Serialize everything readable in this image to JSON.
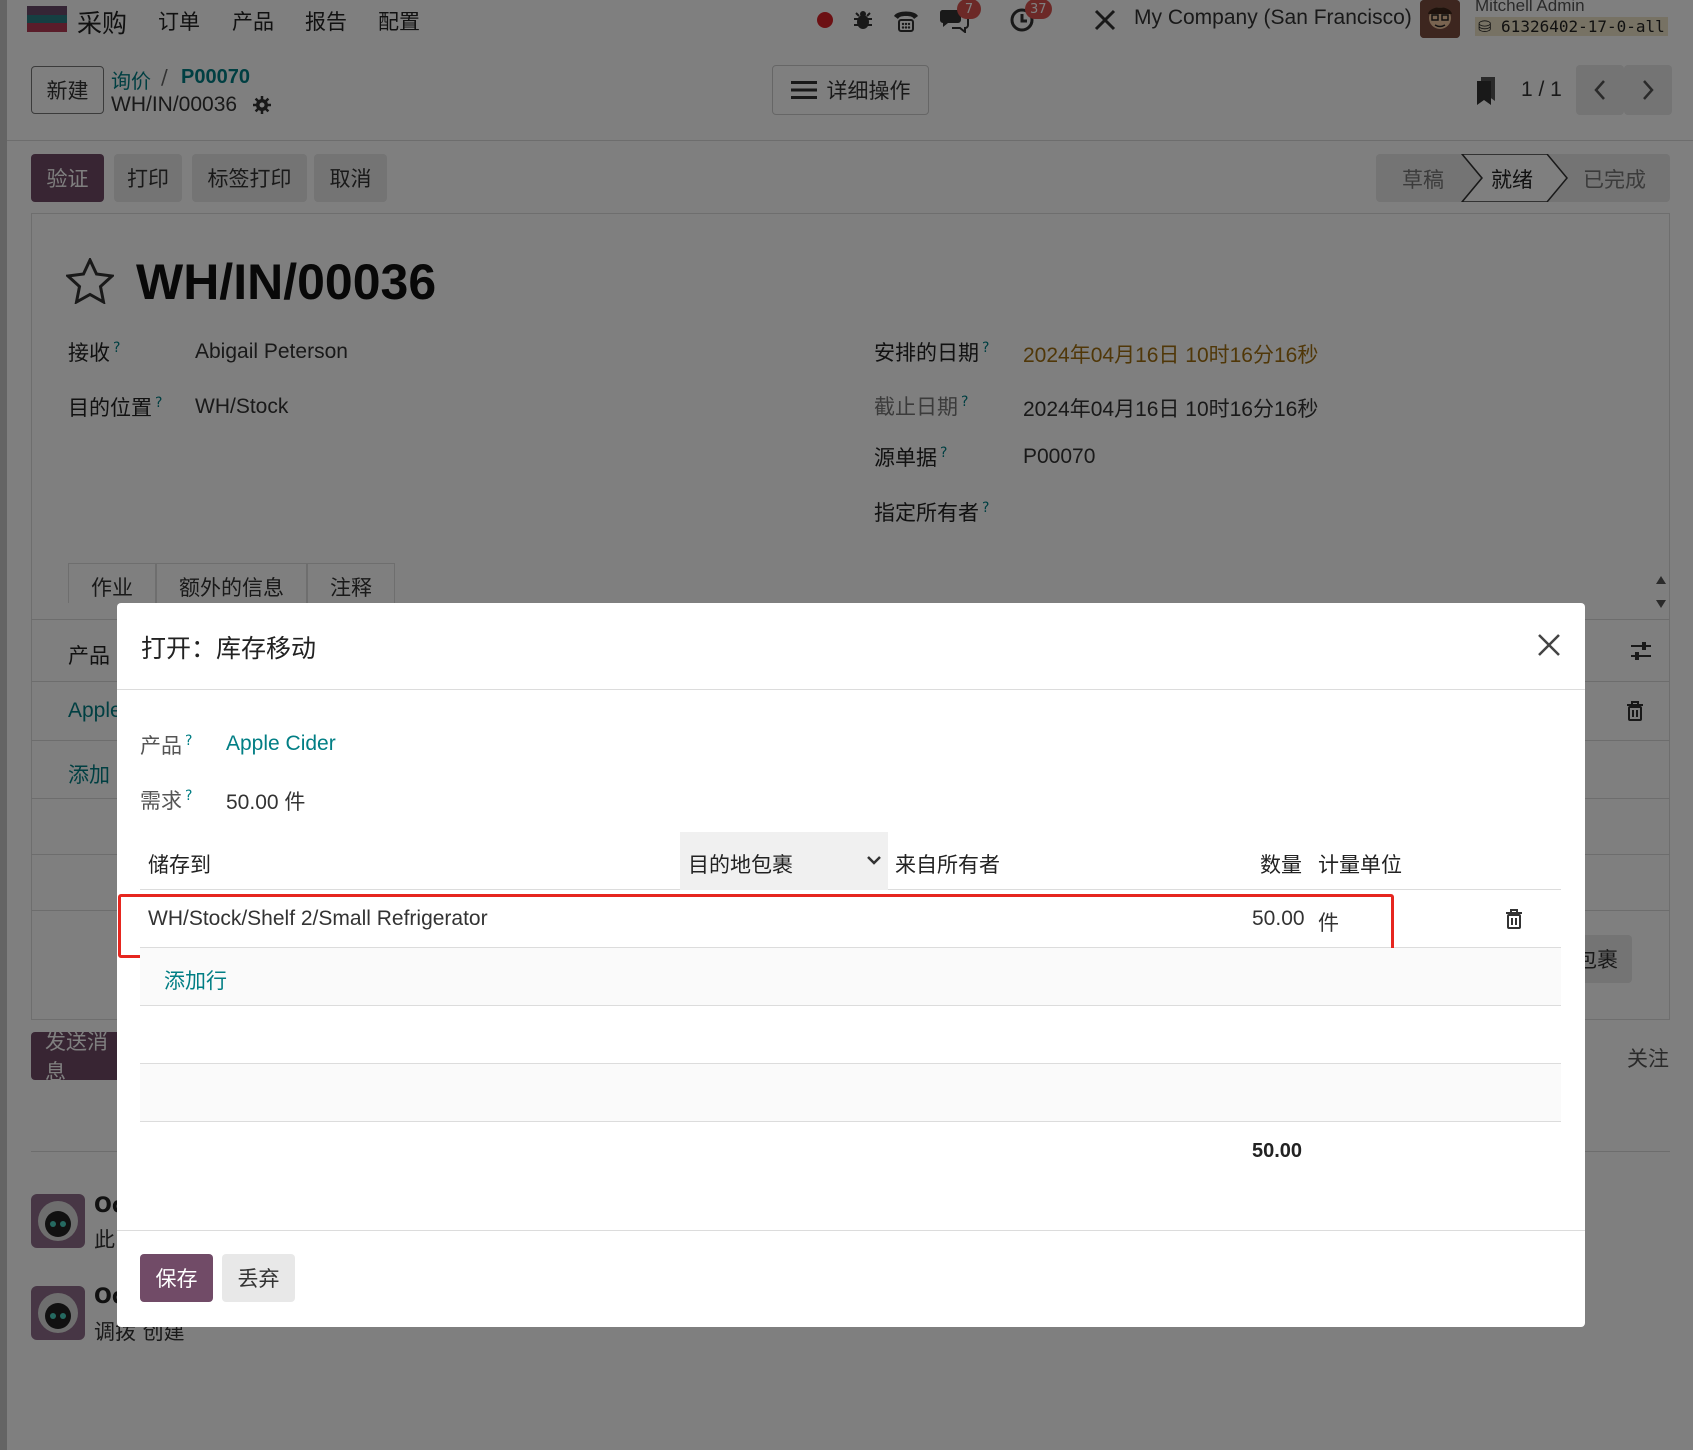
{
  "topnav": {
    "app_name": "采购",
    "menus": [
      "订单",
      "产品",
      "报告",
      "配置"
    ],
    "messages_badge": "7",
    "activities_badge": "37",
    "company": "My Company (San Francisco)",
    "user_name": "Mitchell Admin",
    "db_name": "61326402-17-0-all"
  },
  "control": {
    "new_label": "新建",
    "breadcrumb_parent": "询价",
    "breadcrumb_current": "P00070",
    "record_ref": "WH/IN/00036",
    "actions_label": "详细操作",
    "pager": "1 / 1"
  },
  "buttons": {
    "validate": "验证",
    "print": "打印",
    "print_labels": "标签打印",
    "cancel": "取消"
  },
  "status": {
    "steps": [
      "草稿",
      "就绪",
      "已完成"
    ],
    "active": "就绪"
  },
  "form": {
    "title": "WH/IN/00036",
    "receive_from_label": "接收",
    "receive_from": "Abigail Peterson",
    "dest_location_label": "目的位置",
    "dest_location": "WH/Stock",
    "scheduled_date_label": "安排的日期",
    "scheduled_date": "2024年04月16日 10时16分16秒",
    "deadline_label": "截止日期",
    "deadline": "2024年04月16日 10时16分16秒",
    "source_doc_label": "源单据",
    "source_doc": "P00070",
    "owner_label": "指定所有者",
    "tabs": [
      "作业",
      "额外的信息",
      "注释"
    ],
    "bg_product_header": "产品",
    "bg_product_row": "Apple",
    "bg_add": "添加",
    "bg_package_btn": "包裹",
    "bg_send_msg": "发送消息",
    "bg_follow": "关注",
    "bg_log1_author": "Od",
    "bg_log1_text": "此",
    "bg_log2_author": "Od",
    "bg_log2_text": "调拨 创建"
  },
  "modal": {
    "title": "打开：库存移动",
    "product_label": "产品",
    "product": "Apple Cider",
    "demand_label": "需求",
    "demand": "50.00 件",
    "columns": {
      "store_to": "储存到",
      "dest_package": "目的地包裹",
      "from_owner": "来自所有者",
      "quantity": "数量",
      "uom": "计量单位"
    },
    "rows": [
      {
        "location": "WH/Stock/Shelf 2/Small Refrigerator",
        "quantity": "50.00",
        "uom": "件"
      }
    ],
    "add_line": "添加行",
    "total": "50.00",
    "save": "保存",
    "discard": "丢弃"
  },
  "colors": {
    "primary": "#714b67",
    "link": "#017e84",
    "highlight": "#e6261f",
    "date_warning": "#a06f10"
  }
}
